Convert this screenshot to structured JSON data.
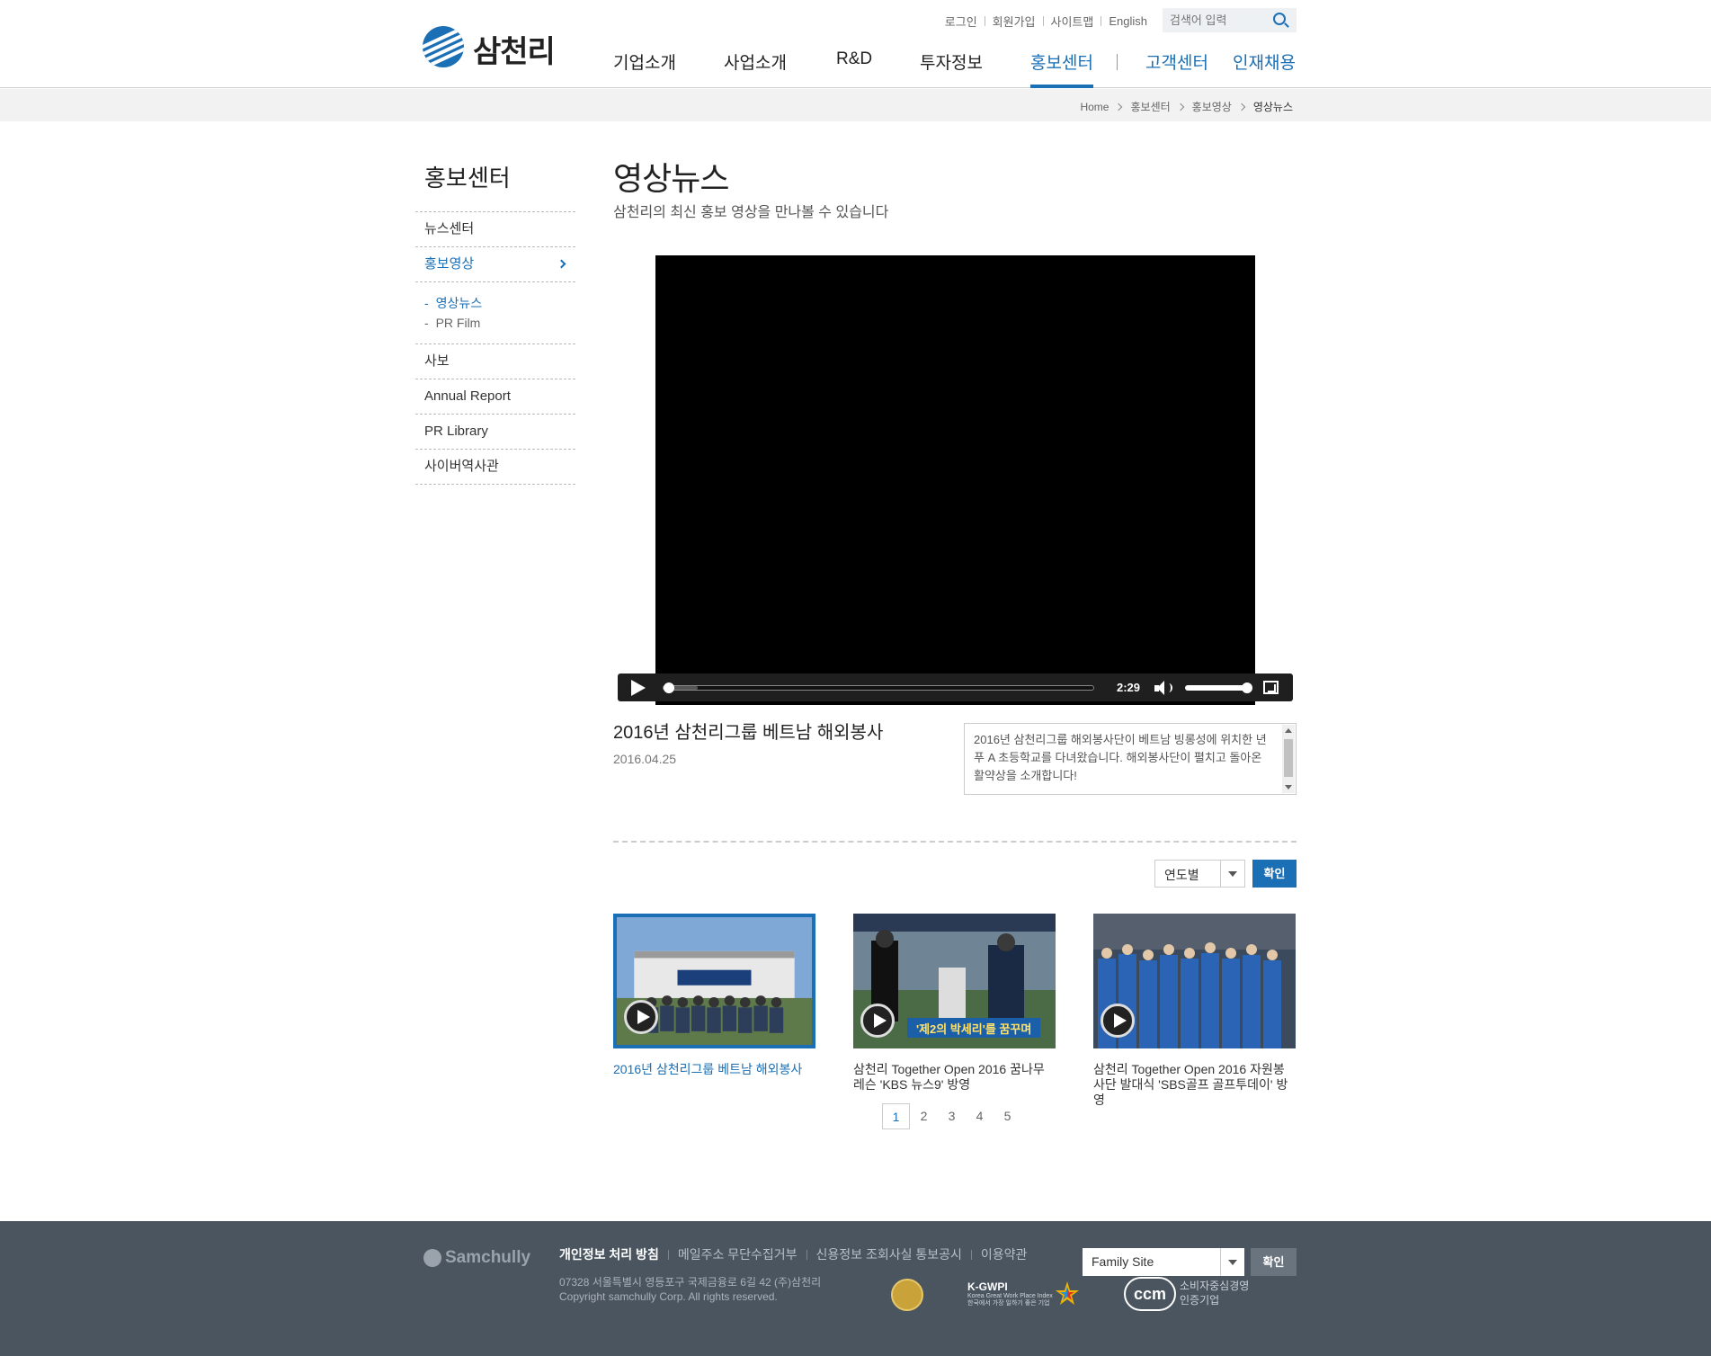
{
  "header": {
    "logo_text": "삼천리",
    "util_links": [
      "로그인",
      "회원가입",
      "사이트맵",
      "English"
    ],
    "search_placeholder": "검색어 입력",
    "gnb": [
      "기업소개",
      "사업소개",
      "R&D",
      "투자정보",
      "홍보센터",
      "고객센터",
      "인재채용"
    ],
    "gnb_active": "홍보센터"
  },
  "breadcrumb": [
    "Home",
    "홍보센터",
    "홍보영상",
    "영상뉴스"
  ],
  "lnb": {
    "title": "홍보센터",
    "items": [
      "뉴스센터",
      "홍보영상",
      "사보",
      "Annual Report",
      "PR Library",
      "사이버역사관"
    ],
    "sub_items": [
      "영상뉴스",
      "PR Film"
    ],
    "active": "홍보영상",
    "active_sub": "영상뉴스"
  },
  "page": {
    "title": "영상뉴스",
    "subtitle": "삼천리의 최신 홍보 영상을 만나볼 수 있습니다"
  },
  "player": {
    "time": "2:29",
    "progress": 0.0,
    "buffered": 0.08,
    "volume": 1.0
  },
  "video": {
    "title": "2016년 삼천리그룹 베트남 해외봉사",
    "date": "2016.04.25",
    "description": "2016년 삼천리그룹 해외봉사단이 베트남 빙롱성에 위치한 년푸 A 초등학교를 다녀왔습니다. 해외봉사단이 펼치고 돌아온 활약상을 소개합니다!"
  },
  "filter": {
    "year_select": "연도별",
    "confirm": "확인"
  },
  "cards": [
    {
      "caption": "2016년 삼천리그룹 베트남 해외봉사",
      "selected": true,
      "banner": ""
    },
    {
      "caption": "삼천리 Together Open 2016 꿈나무레슨 'KBS 뉴스9' 방영",
      "selected": false,
      "banner": "'제2의 박세리'를 꿈꾸며"
    },
    {
      "caption": "삼천리 Together Open 2016 자원봉사단 발대식 'SBS골프 골프투데이' 방영",
      "selected": false,
      "banner": ""
    }
  ],
  "pagination": {
    "pages": [
      "1",
      "2",
      "3",
      "4",
      "5"
    ],
    "current": "1"
  },
  "footer": {
    "logo_text": "Samchully",
    "links": [
      "개인정보 처리 방침",
      "메일주소 무단수집거부",
      "신용정보 조회사실 통보공시",
      "이용약관"
    ],
    "address": "07328 서울특별시 영등포구 국제금융로 6길 42 (주)삼천리",
    "copyright": "Copyright samchully Corp. All rights reserved.",
    "family_site": "Family Site",
    "family_confirm": "확인",
    "kgwpi_title": "K-GWPI",
    "kgwpi_sub1": "Korea Great Work Place Index",
    "kgwpi_sub2": "한국에서 가장 일하기 좋은 기업",
    "ccm_logo": "ccm",
    "ccm_text1": "소비자중심경영",
    "ccm_text2": "인증기업"
  },
  "colors": {
    "brand_blue": "#1b6fb5",
    "footer_bg": "#4a5560"
  }
}
